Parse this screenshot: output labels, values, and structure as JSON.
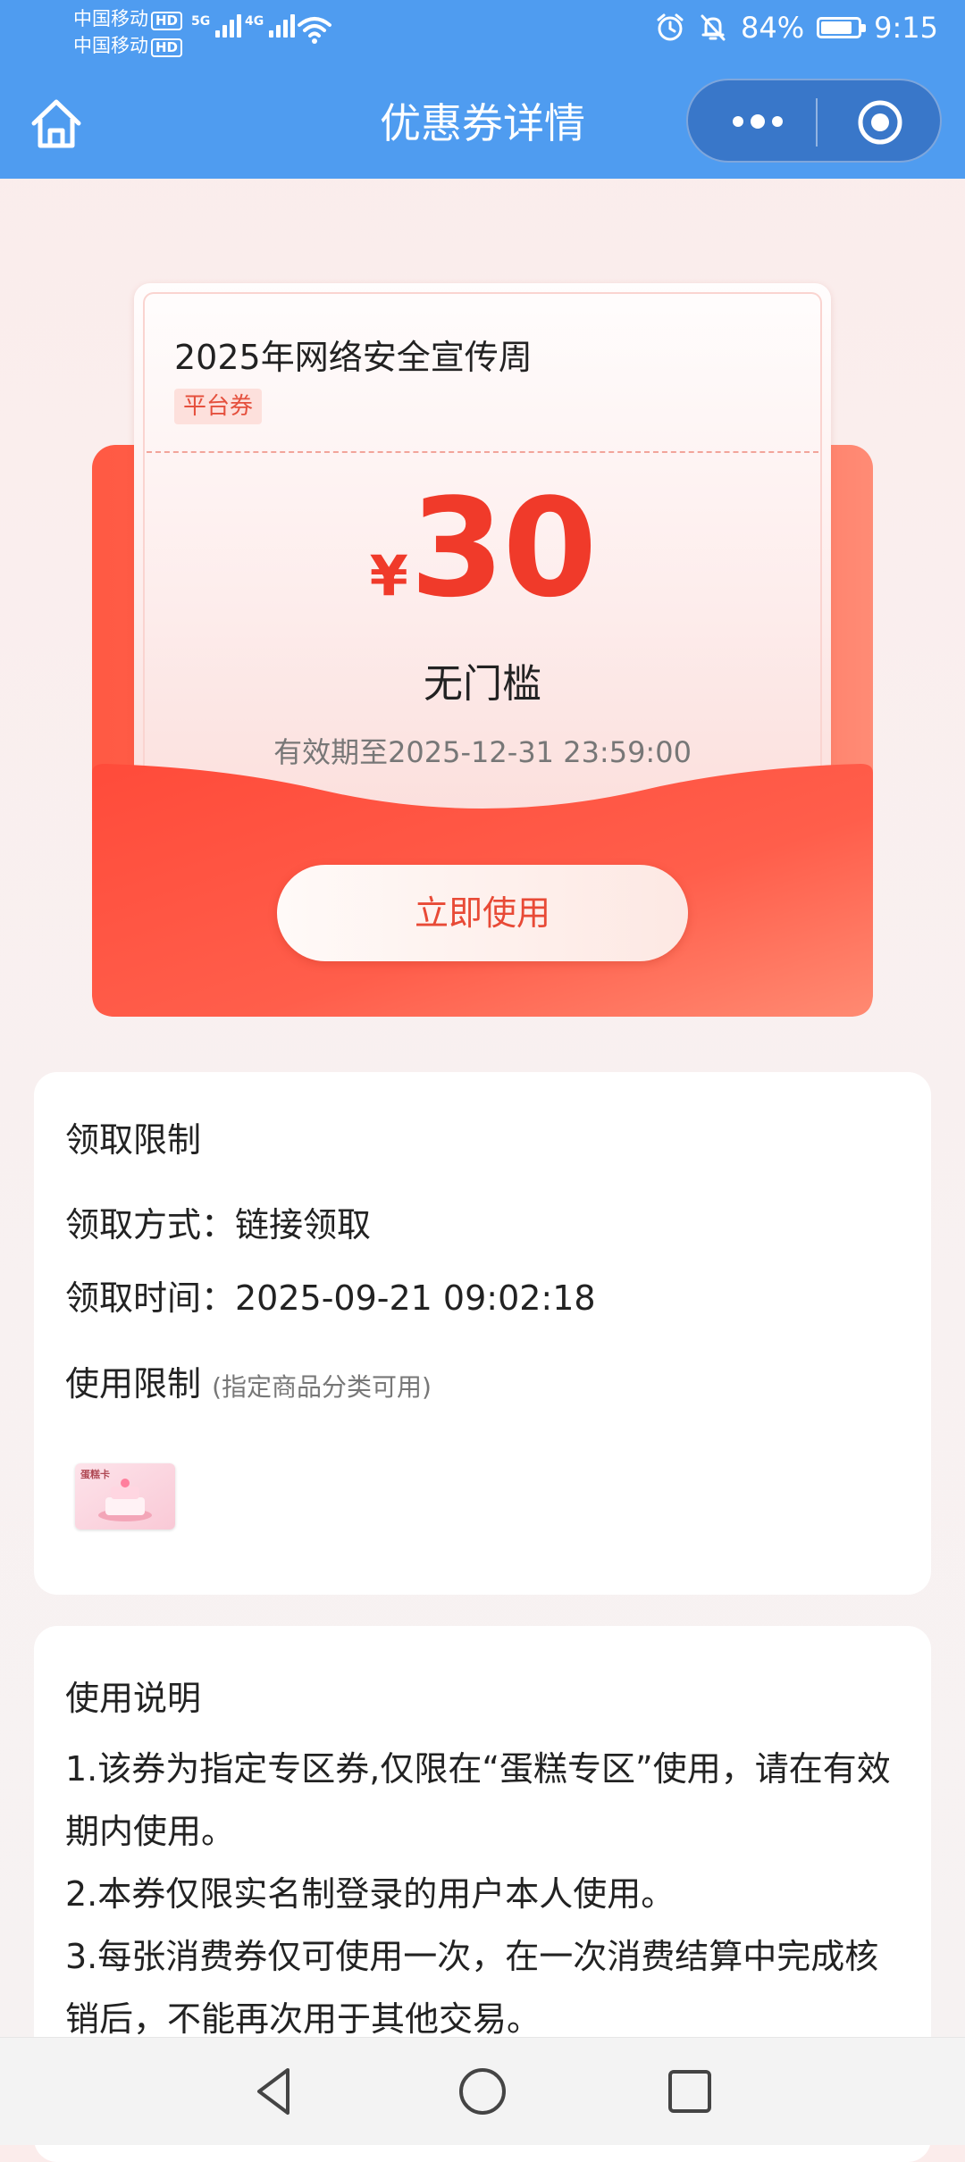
{
  "status_bar": {
    "carrier_1": "中国移动",
    "carrier_2": "中国移动",
    "hd_badge": "HD",
    "network_1": "5G",
    "network_2": "4G",
    "battery_percent": "84%",
    "battery_level": 0.84,
    "time": "9:15"
  },
  "title_bar": {
    "title": "优惠券详情"
  },
  "coupon": {
    "name": "2025年网络安全宣传周",
    "tag": "平台券",
    "currency": "¥",
    "amount": "30",
    "condition": "无门槛",
    "validity": "有效期至2025-12-31 23:59:00",
    "use_button": "立即使用"
  },
  "claim_card": {
    "heading": "领取限制",
    "method": "领取方式：链接领取",
    "time": "领取时间：2025-09-21 09:02:18",
    "usage_heading": "使用限制",
    "usage_sub": "(指定商品分类可用)",
    "category_label": "蛋糕卡"
  },
  "instructions": {
    "heading": "使用说明",
    "items": [
      "1.该券为指定专区券,仅限在“蛋糕专区”使用，请在有效期内使用。",
      "2.本券仅限实名制登录的用户本人使用。",
      "3.每张消费券仅可使用一次，在一次消费结算中完成核销后，不能再次用于其他交易。"
    ]
  },
  "colors": {
    "header": "#4f9cf0",
    "accent_red": "#f03a2a",
    "envelope": "#ff5a44"
  }
}
